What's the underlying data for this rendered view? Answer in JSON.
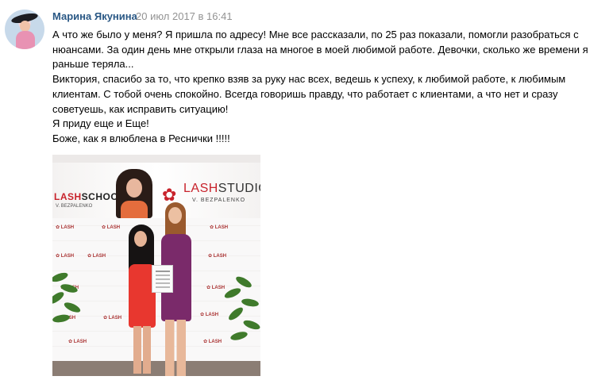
{
  "post": {
    "author": "Марина Якунина",
    "date": "20 июл 2017 в 16:41",
    "text_lines": [
      "А что же было у меня? Я пришла по адресу! Мне все рассказали, по 25 раз показали, помогли разобраться с нюансами. За один день мне открыли глаза на многое в моей любимой работе. Девочки, сколько же времени я раньше теряла...",
      "Виктория, спасибо за то, что крепко взяв за руку нас всех, ведешь к успеху, к любимой работе, к любимым клиентам. С тобой очень спокойно. Всегда говоришь правду, что работает с клиентами, а что нет и сразу советуешь, как исправить ситуацию!",
      "Я приду еще и Еще!",
      "Боже, как я влюблена в Реснички !!!!!"
    ]
  },
  "photo": {
    "banner_school_lash": "LASH",
    "banner_school_rest": "SCHOOL",
    "banner_school_sub": "V. BEZPALENKO",
    "banner_studio_lash": "LASH",
    "banner_studio_rest": "STUDIO",
    "banner_studio_sub": "V. BEZPALENKO",
    "colors": {
      "brand_red": "#c8232c",
      "link_blue": "#2a5885",
      "meta_gray": "#939393"
    }
  }
}
